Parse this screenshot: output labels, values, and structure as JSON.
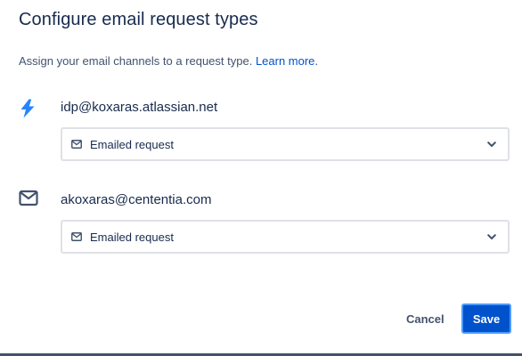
{
  "dialog": {
    "title": "Configure email request types",
    "subtitle_text": "Assign your email channels to a request type.",
    "learn_more_label": "Learn more",
    "subtitle_period": "."
  },
  "channels": [
    {
      "address": "idp@koxaras.atlassian.net",
      "icon": "lightning-bolt-icon",
      "icon_color": "#2684ff",
      "request_type": "Emailed request",
      "request_type_icon": "envelope-icon"
    },
    {
      "address": "akoxaras@cententia.com",
      "icon": "envelope-icon",
      "icon_color": "#42526e",
      "request_type": "Emailed request",
      "request_type_icon": "envelope-icon"
    }
  ],
  "footer": {
    "cancel_label": "Cancel",
    "save_label": "Save"
  },
  "colors": {
    "primary": "#0052cc",
    "link": "#0052cc",
    "text": "#172b4d",
    "subtle_text": "#42526e",
    "border": "#dfe1e6",
    "focus_ring": "#4c9aff"
  }
}
